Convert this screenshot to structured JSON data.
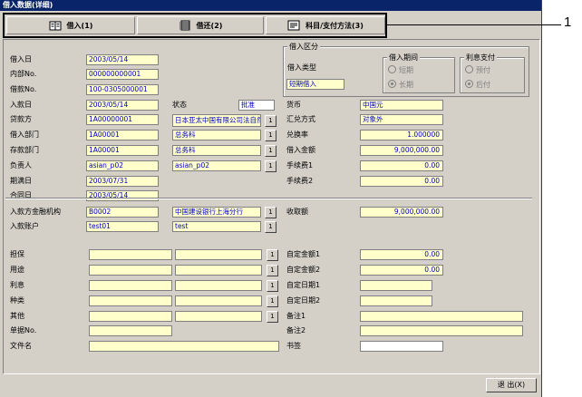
{
  "window": {
    "title": "借入数据(详细)"
  },
  "tabs": [
    {
      "label": "借入(1)",
      "icon": "book-icon"
    },
    {
      "label": "借还(2)",
      "icon": "ledger-icon"
    },
    {
      "label": "科目/支付方法(3)",
      "icon": "document-icon"
    }
  ],
  "callout": {
    "number": "1"
  },
  "left": {
    "borrow_date": {
      "label": "借入日",
      "value": "2003/05/14"
    },
    "internal_no": {
      "label": "内部No.",
      "value": "000000000001"
    },
    "loan_no": {
      "label": "借款No.",
      "value": "100-0305000001"
    },
    "receipt_date": {
      "label": "入款日",
      "value": "2003/05/14"
    },
    "status": {
      "label": "状态",
      "value": "批准"
    },
    "lender": {
      "label": "贷款方",
      "code": "1A00000001",
      "name": "日本亚太中国有限公司法自然人办公"
    },
    "borrow_dept": {
      "label": "借入部门",
      "code": "1A00001",
      "name": "总务科"
    },
    "deposit_dept": {
      "label": "存款部门",
      "code": "1A00001",
      "name": "总务科"
    },
    "person": {
      "label": "负责人",
      "code": "asian_p02",
      "name": "asian_p02"
    },
    "maturity_date": {
      "label": "期满日",
      "value": "2003/07/31"
    },
    "contract_date": {
      "label": "合同日",
      "value": "2003/05/14"
    },
    "bank": {
      "label": "入款方金融机构",
      "code": "B0002",
      "name": "中国建设银行上海分行"
    },
    "account": {
      "label": "入款账户",
      "code": "test01",
      "name": "test"
    }
  },
  "right": {
    "group_title": "借入区分",
    "loan_type": {
      "label": "借入类型",
      "value": "短期借入"
    },
    "period_group": {
      "title": "借入期间",
      "options": [
        "短期",
        "长期"
      ],
      "selected": "长期"
    },
    "interest_group": {
      "title": "利息支付",
      "options": [
        "预付",
        "后付"
      ],
      "selected": "后付"
    },
    "currency": {
      "label": "货币",
      "value": "中国元"
    },
    "exchange_method": {
      "label": "汇兑方式",
      "value": "对象外"
    },
    "exchange_rate": {
      "label": "兑换率",
      "value": "1.000000"
    },
    "borrow_amount": {
      "label": "借入金额",
      "value": "9,000,000.00"
    },
    "fee1": {
      "label": "手续费1",
      "value": "0.00"
    },
    "fee2": {
      "label": "手续费2",
      "value": "0.00"
    },
    "received_amount": {
      "label": "收取额",
      "value": "9,000,000.00"
    }
  },
  "bottom": {
    "guarantee": {
      "label": "担保"
    },
    "usage": {
      "label": "用途"
    },
    "interest": {
      "label": "利息"
    },
    "kind": {
      "label": "种类"
    },
    "other": {
      "label": "其他"
    },
    "voucher_no": {
      "label": "单据No."
    },
    "file_name": {
      "label": "文件名"
    },
    "custom_amount1": {
      "label": "自定金额1",
      "value": "0.00"
    },
    "custom_amount2": {
      "label": "自定金额2",
      "value": "0.00"
    },
    "custom_date1": {
      "label": "自定日期1"
    },
    "custom_date2": {
      "label": "自定日期2"
    },
    "remark1": {
      "label": "备注1"
    },
    "remark2": {
      "label": "备注2"
    },
    "bookmark": {
      "label": "书签"
    }
  },
  "lookup_button_label": "1",
  "exit_button": {
    "label": "退 出(X)"
  }
}
